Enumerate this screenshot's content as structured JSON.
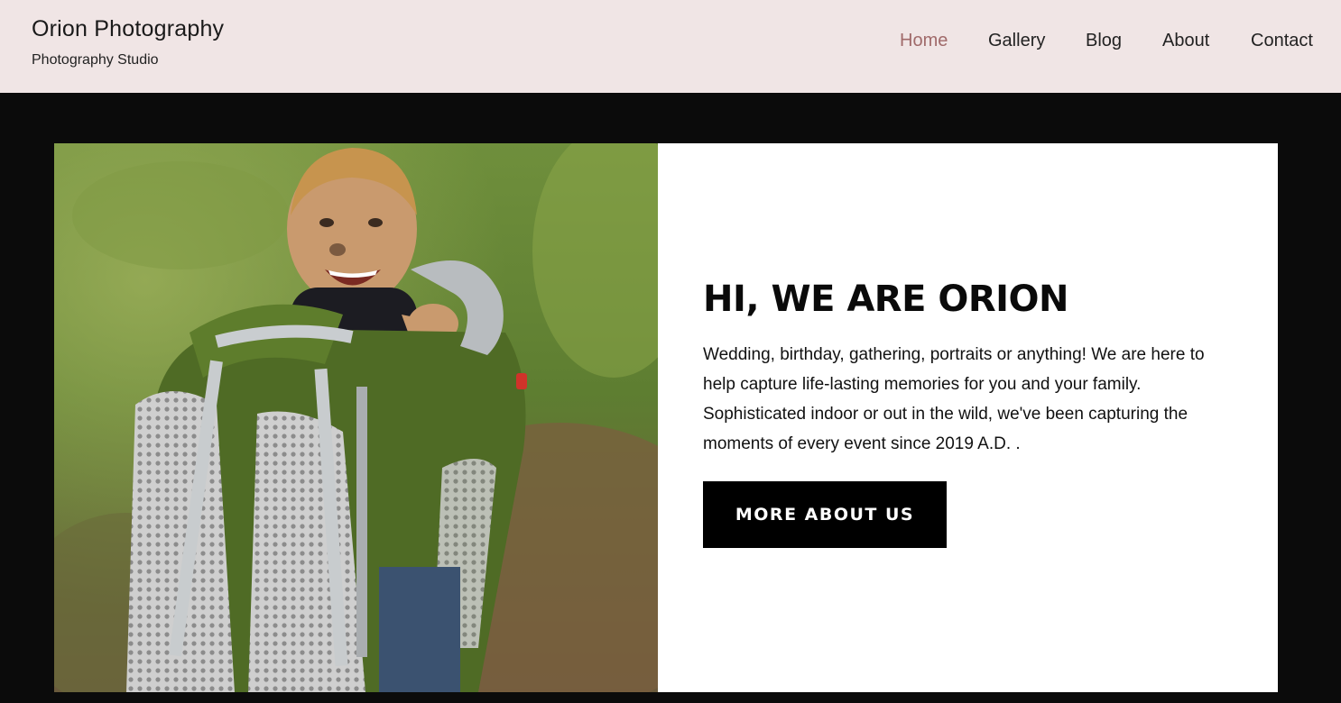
{
  "header": {
    "site_title": "Orion Photography",
    "tagline": "Photography Studio"
  },
  "nav": {
    "items": [
      {
        "label": "Home",
        "active": true
      },
      {
        "label": "Gallery",
        "active": false
      },
      {
        "label": "Blog",
        "active": false
      },
      {
        "label": "About",
        "active": false
      },
      {
        "label": "Contact",
        "active": false
      }
    ]
  },
  "hero": {
    "image_subject": "smiling toddler in green child-carrier backpack outdoors",
    "heading": "HI, WE ARE ORION",
    "text": "Wedding, birthday, gathering, portraits or anything! We are here to help capture life-lasting memories for you and your family. Sophisticated indoor or out in the wild, we've been capturing the moments of every event since 2019 A.D. .",
    "button_label": "MORE ABOUT US"
  },
  "colors": {
    "header_bg": "#f0e5e5",
    "page_bg": "#0b0b0b",
    "nav_active": "#a06a6a",
    "button_bg": "#000000"
  }
}
